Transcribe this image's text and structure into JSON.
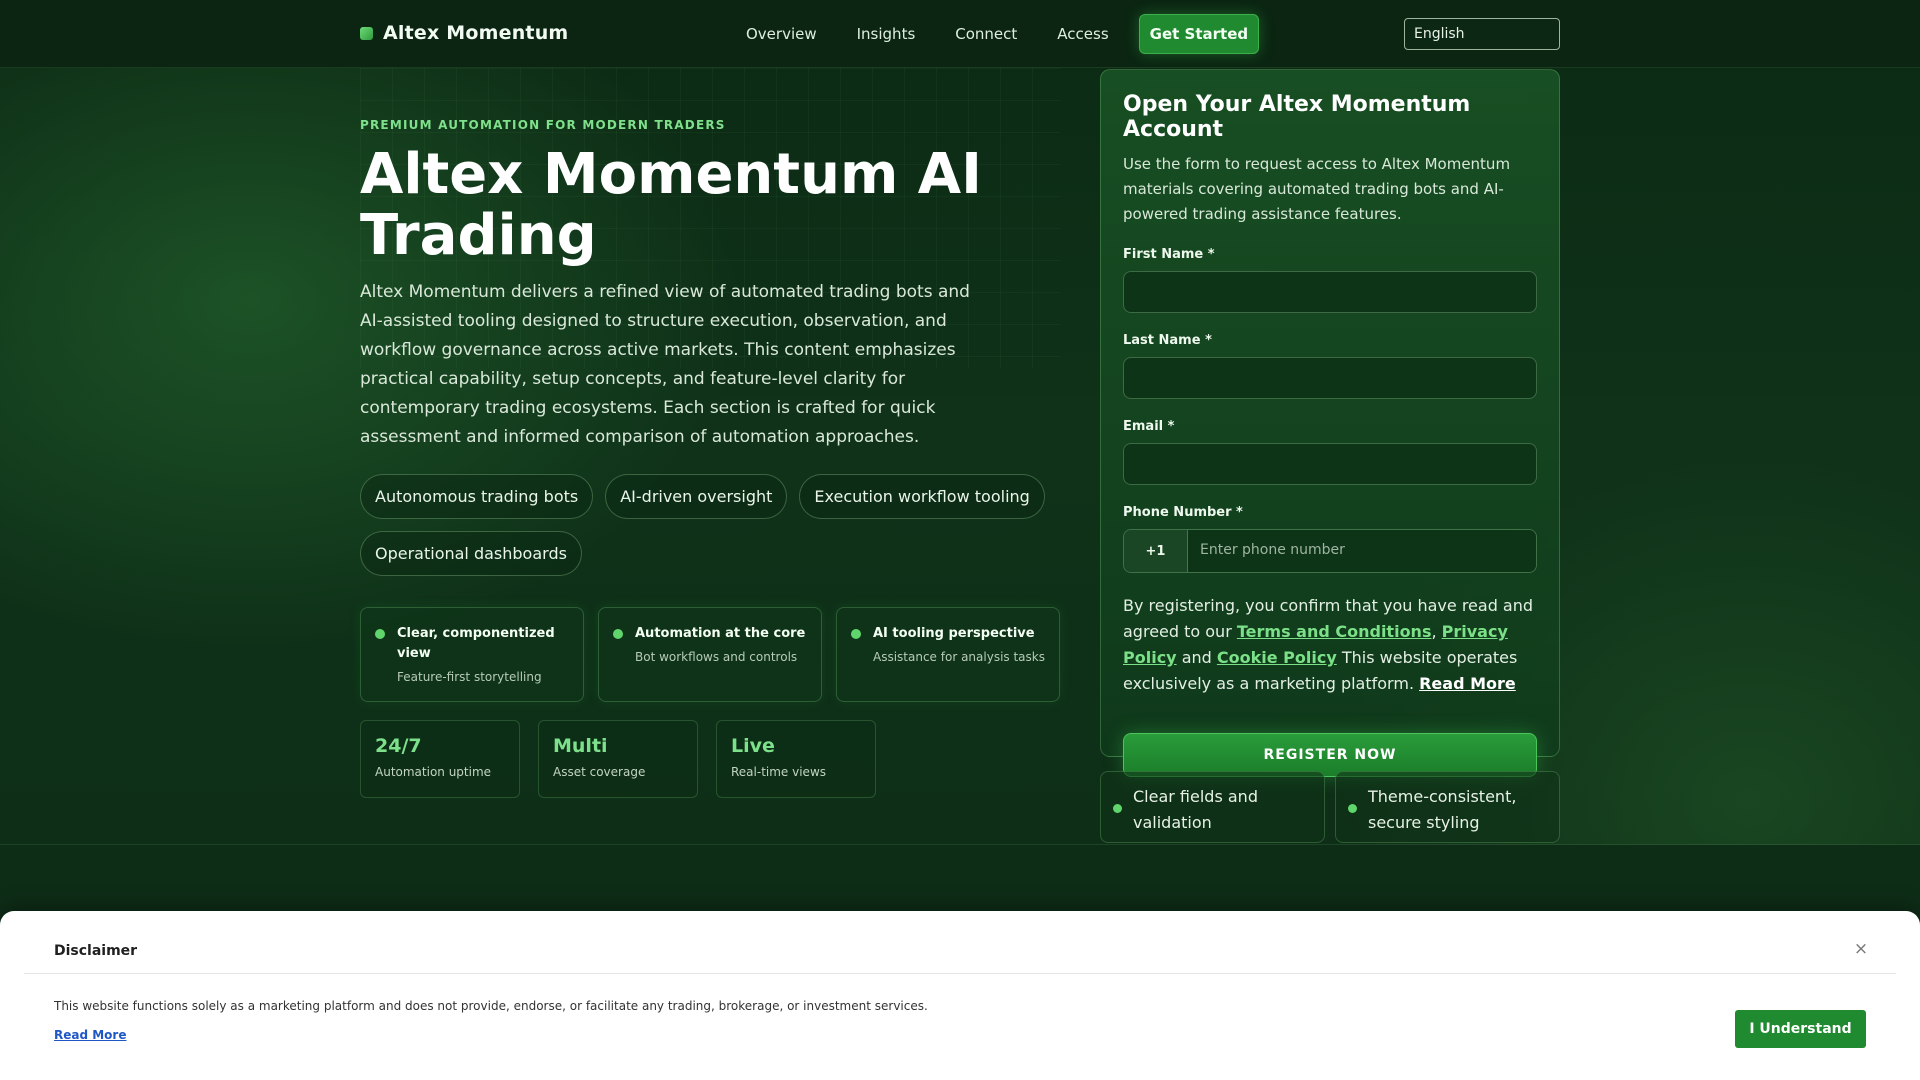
{
  "header": {
    "brand": "Altex Momentum",
    "nav": [
      "Overview",
      "Insights",
      "Connect",
      "Access"
    ],
    "cta": "Get Started",
    "language": "English"
  },
  "hero": {
    "eyebrow": "PREMIUM AUTOMATION FOR MODERN TRADERS",
    "title": "Altex Momentum AI Trading",
    "description": "Altex Momentum delivers a refined view of automated trading bots and AI-assisted tooling designed to structure execution, observation, and workflow governance across active markets. This content emphasizes practical capability, setup concepts, and feature-level clarity for contemporary trading ecosystems. Each section is crafted for quick assessment and informed comparison of automation approaches.",
    "chips": [
      "Autonomous trading bots",
      "AI-driven oversight",
      "Execution workflow tooling",
      "Operational dashboards"
    ],
    "features": [
      {
        "title": "Clear, componentized view",
        "subtitle": "Feature-first storytelling"
      },
      {
        "title": "Automation at the core",
        "subtitle": "Bot workflows and controls"
      },
      {
        "title": "AI tooling perspective",
        "subtitle": "Assistance for analysis tasks"
      }
    ],
    "stats": [
      {
        "value": "24/7",
        "label": "Automation uptime"
      },
      {
        "value": "Multi",
        "label": "Asset coverage"
      },
      {
        "value": "Live",
        "label": "Real-time views"
      }
    ]
  },
  "form": {
    "title": "Open Your Altex Momentum Account",
    "description": "Use the form to request access to Altex Momentum materials covering automated trading bots and AI-powered trading assistance features.",
    "first_name_label": "First Name *",
    "last_name_label": "Last Name *",
    "email_label": "Email *",
    "phone_label": "Phone Number *",
    "phone_code": "+1",
    "phone_placeholder": "Enter phone number",
    "consent_prefix": "By registering, you confirm that you have read and agreed to our ",
    "terms_link": "Terms and Conditions",
    "comma": ", ",
    "privacy_link": "Privacy Policy",
    "and": " and ",
    "cookie_link": "Cookie Policy",
    "consent_suffix": " This website operates exclusively as a marketing platform. ",
    "read_more": "Read More",
    "register": "REGISTER NOW"
  },
  "mini_cards": [
    "Clear fields and validation",
    "Theme-consistent, secure styling"
  ],
  "disclaimer": {
    "title": "Disclaimer",
    "close": "×",
    "text": "This website functions solely as a marketing platform and does not provide, endorse, or facilitate any trading, brokerage, or investment services.",
    "read_more": "Read More",
    "button": "I Understand"
  }
}
